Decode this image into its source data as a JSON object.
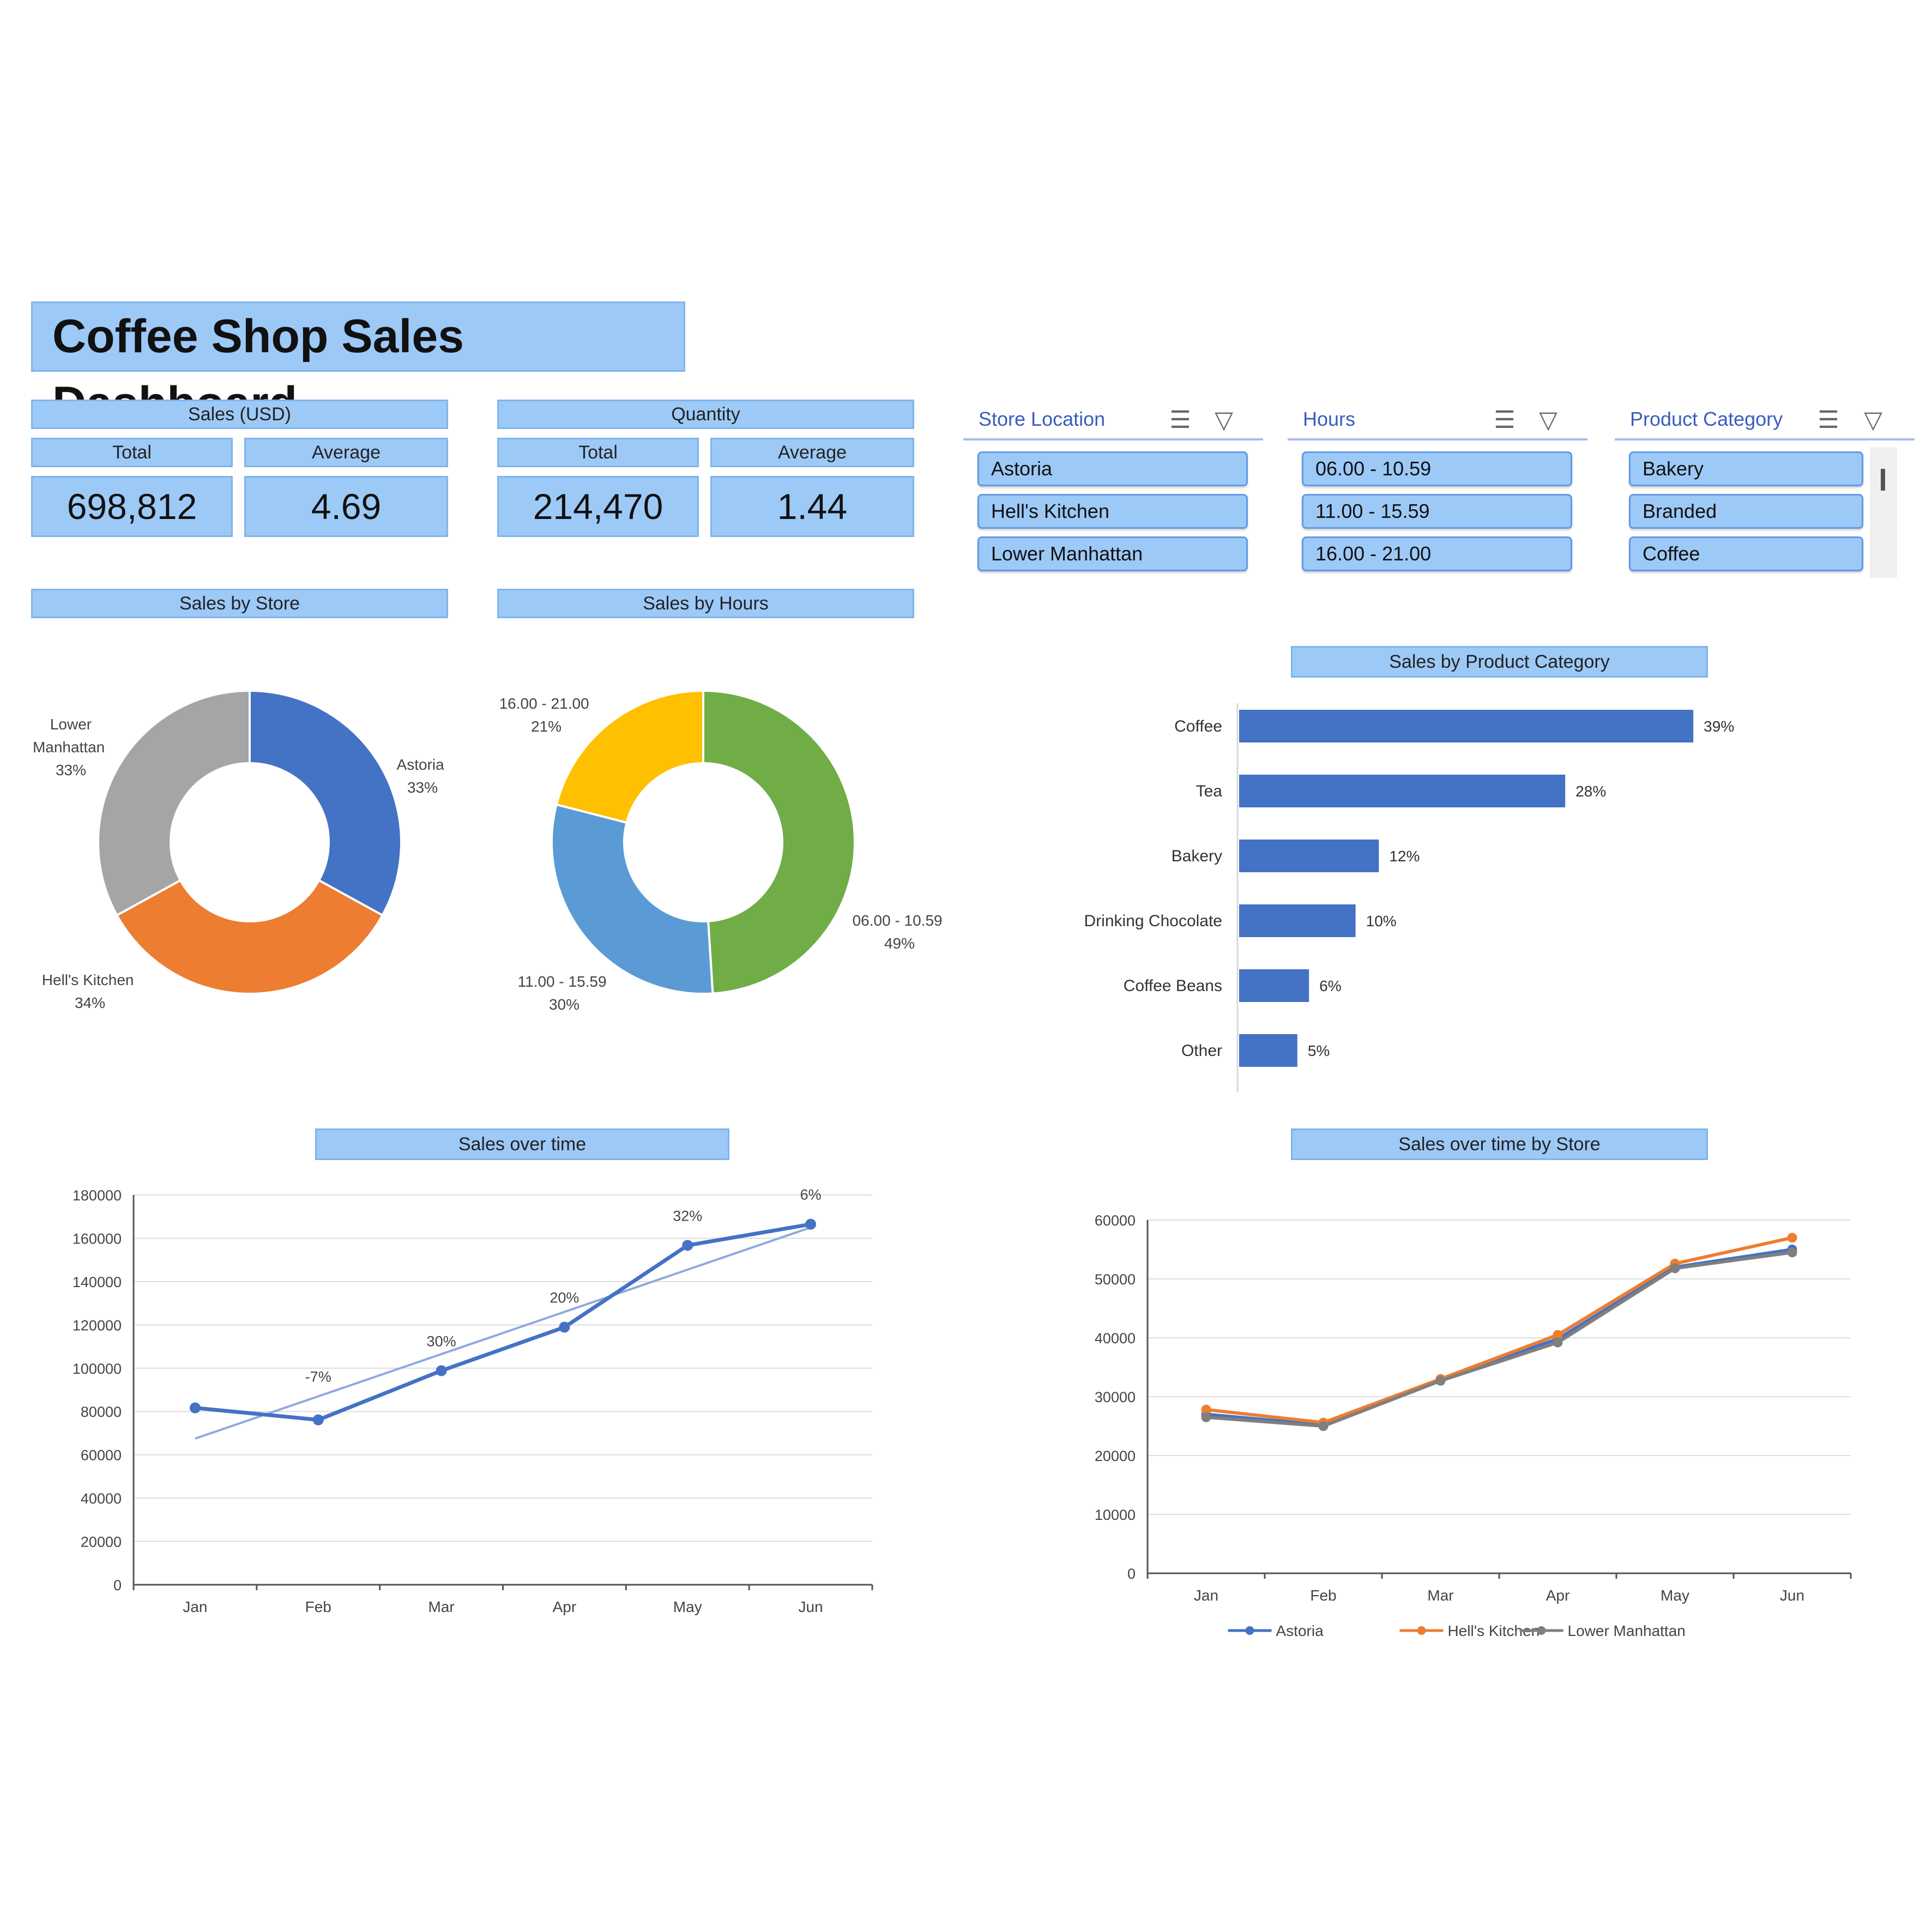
{
  "dashboard": {
    "title": "Coffee Shop Sales Dashboard"
  },
  "kpis": {
    "sales": {
      "header": "Sales (USD)",
      "total_label": "Total",
      "average_label": "Average",
      "total": "698,812",
      "average": "4.69"
    },
    "quantity": {
      "header": "Quantity",
      "total_label": "Total",
      "average_label": "Average",
      "total": "214,470",
      "average": "1.44"
    }
  },
  "slicers": [
    {
      "title": "Store Location",
      "items": [
        "Astoria",
        "Hell's Kitchen",
        "Lower Manhattan"
      ]
    },
    {
      "title": "Hours",
      "items": [
        "06.00 - 10.59",
        "11.00 - 15.59",
        "16.00 - 21.00"
      ]
    },
    {
      "title": "Product Category",
      "items": [
        "Bakery",
        "Branded",
        "Coffee"
      ]
    }
  ],
  "icons": {
    "multi_select": "multi-select-icon",
    "clear_filter": "clear-filter-icon",
    "scrollbar": "scrollbar-thumb"
  },
  "colors": {
    "header_fill": "#9dc9f7",
    "blue": "#4472c4",
    "orange": "#ed7d31",
    "gray": "#a5a5a5",
    "green": "#70ad47",
    "yellow": "#ffc000",
    "light_blue": "#5b9bd5"
  },
  "chart_data": [
    {
      "id": "sales_by_store",
      "type": "pie",
      "title": "Sales by Store",
      "donut": true,
      "slices": [
        {
          "label": "Astoria",
          "value": 33,
          "pct_label": "33%",
          "color": "#4472c4"
        },
        {
          "label": "Hell's Kitchen",
          "value": 34,
          "pct_label": "34%",
          "color": "#ed7d31"
        },
        {
          "label": "Lower Manhattan",
          "value": 33,
          "pct_label": "33%",
          "color": "#a5a5a5"
        }
      ]
    },
    {
      "id": "sales_by_hours",
      "type": "pie",
      "title": "Sales by Hours",
      "donut": true,
      "slices": [
        {
          "label": "06.00 - 10.59",
          "value": 49,
          "pct_label": "49%",
          "color": "#70ad47"
        },
        {
          "label": "11.00 - 15.59",
          "value": 30,
          "pct_label": "30%",
          "color": "#5b9bd5"
        },
        {
          "label": "16.00 - 21.00",
          "value": 21,
          "pct_label": "21%",
          "color": "#ffc000"
        }
      ]
    },
    {
      "id": "sales_by_product_category",
      "type": "bar",
      "orientation": "horizontal",
      "title": "Sales by Product Category",
      "categories": [
        "Coffee",
        "Tea",
        "Bakery",
        "Drinking Chocolate",
        "Coffee Beans",
        "Other"
      ],
      "values": [
        39,
        28,
        12,
        10,
        6,
        5
      ],
      "value_labels": [
        "39%",
        "28%",
        "12%",
        "10%",
        "6%",
        "5%"
      ],
      "color": "#4472c4",
      "xlim": [
        0,
        44
      ]
    },
    {
      "id": "sales_over_time",
      "type": "line",
      "title": "Sales over time",
      "categories": [
        "Jan",
        "Feb",
        "Mar",
        "Apr",
        "May",
        "Jun"
      ],
      "series": [
        {
          "values": [
            81677,
            76145,
            98834,
            118941,
            156728,
            166486
          ],
          "color": "#4472c4"
        }
      ],
      "trendline": {
        "start": 67500,
        "end": 165000,
        "color": "#8fa8e0"
      },
      "data_labels": [
        "",
        "-7%",
        "30%",
        "20%",
        "32%",
        "6%"
      ],
      "ylim": [
        0,
        180000
      ],
      "yticks": [
        "0",
        "20000",
        "40000",
        "60000",
        "80000",
        "100000",
        "120000",
        "140000",
        "160000",
        "180000"
      ],
      "grid": true
    },
    {
      "id": "sales_over_time_by_store",
      "type": "line",
      "title": "Sales over time by Store",
      "categories": [
        "Jan",
        "Feb",
        "Mar",
        "Apr",
        "May",
        "Jun"
      ],
      "series": [
        {
          "name": "Astoria",
          "values": [
            27000,
            25200,
            33000,
            39800,
            52000,
            55000
          ],
          "color": "#4472c4"
        },
        {
          "name": "Hell's Kitchen",
          "values": [
            27800,
            25600,
            33000,
            40500,
            52600,
            57000
          ],
          "color": "#ed7d31"
        },
        {
          "name": "Lower Manhattan",
          "values": [
            26500,
            25000,
            32700,
            39200,
            51800,
            54500
          ],
          "color": "#7f7f7f"
        }
      ],
      "ylim": [
        0,
        60000
      ],
      "yticks": [
        "0",
        "10000",
        "20000",
        "30000",
        "40000",
        "50000",
        "60000"
      ],
      "grid": true,
      "legend": "bottom"
    }
  ]
}
